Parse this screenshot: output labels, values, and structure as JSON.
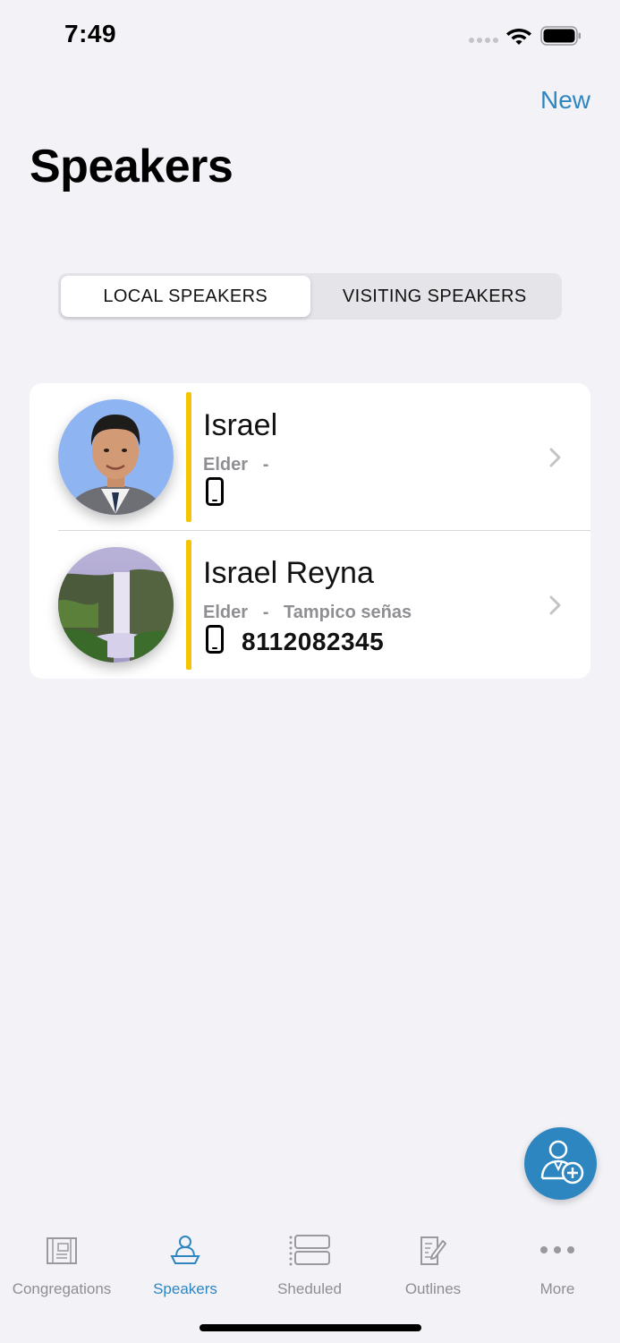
{
  "status_bar": {
    "time": "7:49"
  },
  "header": {
    "new_label": "New",
    "title": "Speakers"
  },
  "segments": [
    {
      "label": "LOCAL SPEAKERS",
      "active": true
    },
    {
      "label": "VISITING SPEAKERS",
      "active": false
    }
  ],
  "speakers": [
    {
      "name": "Israel",
      "role": "Elder",
      "separator": "-",
      "congregation": "",
      "phone": "",
      "avatar": "portrait-photo"
    },
    {
      "name": "Israel Reyna",
      "role": "Elder",
      "separator": "-",
      "congregation": "Tampico señas",
      "phone": "8112082345",
      "avatar": "waterfall-photo"
    }
  ],
  "tabs": [
    {
      "label": "Congregations",
      "icon": "building-icon",
      "active": false
    },
    {
      "label": "Speakers",
      "icon": "speaker-podium-icon",
      "active": true
    },
    {
      "label": "Sheduled",
      "icon": "schedule-list-icon",
      "active": false
    },
    {
      "label": "Outlines",
      "icon": "document-edit-icon",
      "active": false
    },
    {
      "label": "More",
      "icon": "more-dots-icon",
      "active": false
    }
  ],
  "colors": {
    "accent": "#2e86c1",
    "speaker_bar": "#f4c400",
    "background": "#f2f2f7"
  }
}
